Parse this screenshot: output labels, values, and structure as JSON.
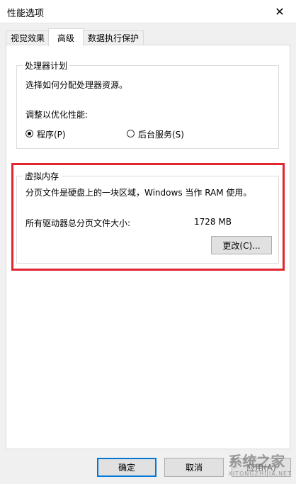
{
  "window": {
    "title": "性能选项",
    "close_glyph": "✕"
  },
  "tabs": [
    {
      "label": "视觉效果"
    },
    {
      "label": "高级"
    },
    {
      "label": "数据执行保护"
    }
  ],
  "processor": {
    "legend": "处理器计划",
    "description": "选择如何分配处理器资源。",
    "adjust_label": "调整以优化性能:",
    "options": [
      {
        "label": "程序(P)",
        "selected": true
      },
      {
        "label": "后台服务(S)",
        "selected": false
      }
    ]
  },
  "virtual_memory": {
    "legend": "虚拟内存",
    "description": "分页文件是硬盘上的一块区域，Windows 当作 RAM 使用。",
    "total_label": "所有驱动器总分页文件大小:",
    "total_value": "1728 MB",
    "change_button": "更改(C)..."
  },
  "footer": {
    "ok": "确定",
    "cancel": "取消",
    "apply": "应用(A)"
  },
  "watermark": {
    "text": "系统之家",
    "sub": "XITONGZHIJIA.NET"
  },
  "colors": {
    "highlight": "#e0262e",
    "focus": "#0078d7"
  }
}
